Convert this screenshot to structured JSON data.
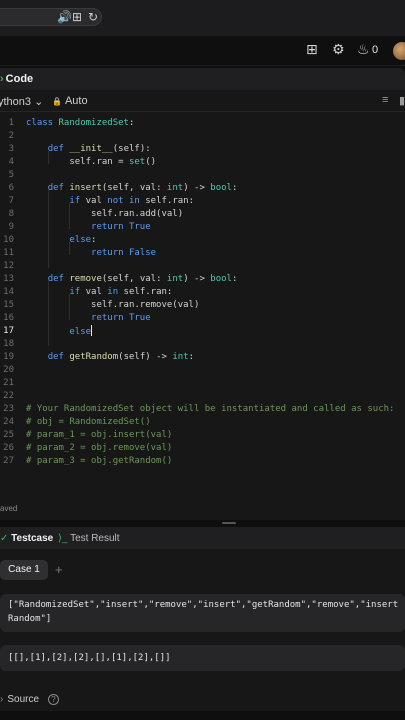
{
  "browser": {
    "icons": [
      "speaker-icon",
      "translate-icon",
      "reload-icon"
    ],
    "speaker_glyph": "🔊",
    "translate_glyph": "⊞",
    "reload_glyph": "↻"
  },
  "header": {
    "icons": [
      "grid-icon",
      "settings-icon",
      "flame-icon"
    ],
    "grid_glyph": "⊞",
    "settings_glyph": "⚙",
    "flame_glyph": "♨",
    "streak_count": "0"
  },
  "editor": {
    "tab_label": "Code",
    "tab_glyph": "›",
    "language": "ython3 ⌄",
    "mode": "Auto",
    "lock_glyph": "🔒",
    "status": "aved",
    "active_line": 17
  },
  "code_lines": [
    {
      "n": "1",
      "html": "<span class=\"kw\">class</span> <span class=\"ty\">RandomizedSet</span>:"
    },
    {
      "n": "2",
      "html": ""
    },
    {
      "n": "3",
      "html": "    <span class=\"kw\">def</span> <span class=\"fn\">__init__</span>(self):"
    },
    {
      "n": "4",
      "html": "        self.ran = <span class=\"ty\">set</span>()"
    },
    {
      "n": "5",
      "html": ""
    },
    {
      "n": "6",
      "html": "    <span class=\"kw\">def</span> <span class=\"fn\">insert</span>(self, val: <span class=\"ty\">int</span>) -> <span class=\"ty\">bool</span>:"
    },
    {
      "n": "7",
      "html": "        <span class=\"kw\">if</span> val <span class=\"kw\">not in</span> self.ran:"
    },
    {
      "n": "8",
      "html": "            self.ran.add(val)"
    },
    {
      "n": "9",
      "html": "            <span class=\"kw\">return</span> <span class=\"kw\">True</span>"
    },
    {
      "n": "10",
      "html": "        <span class=\"kw\">else</span>:"
    },
    {
      "n": "11",
      "html": "            <span class=\"kw\">return</span> <span class=\"kw\">False</span>"
    },
    {
      "n": "12",
      "html": ""
    },
    {
      "n": "13",
      "html": "    <span class=\"kw\">def</span> <span class=\"fn\">remove</span>(self, val: <span class=\"ty\">int</span>) -> <span class=\"ty\">bool</span>:"
    },
    {
      "n": "14",
      "html": "        <span class=\"kw\">if</span> val <span class=\"kw\">in</span> self.ran:"
    },
    {
      "n": "15",
      "html": "            self.ran.remove(val)"
    },
    {
      "n": "16",
      "html": "            <span class=\"kw\">return</span> <span class=\"kw\">True</span>"
    },
    {
      "n": "17",
      "html": "        <span class=\"kw\">else</span><span class=\"cursor\"></span>"
    },
    {
      "n": "18",
      "html": ""
    },
    {
      "n": "19",
      "html": "    <span class=\"kw\">def</span> <span class=\"fn\">getRandom</span>(self) -> <span class=\"ty\">int</span>:"
    },
    {
      "n": "20",
      "html": ""
    },
    {
      "n": "21",
      "html": ""
    },
    {
      "n": "22",
      "html": ""
    },
    {
      "n": "23",
      "html": "<span class=\"cm\"># Your RandomizedSet object will be instantiated and called as such:</span>"
    },
    {
      "n": "24",
      "html": "<span class=\"cm\"># obj = RandomizedSet()</span>"
    },
    {
      "n": "25",
      "html": "<span class=\"cm\"># param_1 = obj.insert(val)</span>"
    },
    {
      "n": "26",
      "html": "<span class=\"cm\"># param_2 = obj.remove(val)</span>"
    },
    {
      "n": "27",
      "html": "<span class=\"cm\"># param_3 = obj.getRandom()</span>"
    }
  ],
  "testcase": {
    "tab_label": "Testcase",
    "tab_glyph": "✓",
    "result_label": "Test Result",
    "result_glyph": "⟩_",
    "case_label": "Case 1",
    "add_glyph": "+",
    "input_1": "[\"RandomizedSet\",\"insert\",\"remove\",\"insert\",\"getRandom\",\"remove\",\"insert\nRandom\"]",
    "input_2": "[[],[1],[2],[2],[],[1],[2],[]]",
    "source_label": "Source",
    "source_glyph": "›",
    "help_glyph": "?"
  }
}
